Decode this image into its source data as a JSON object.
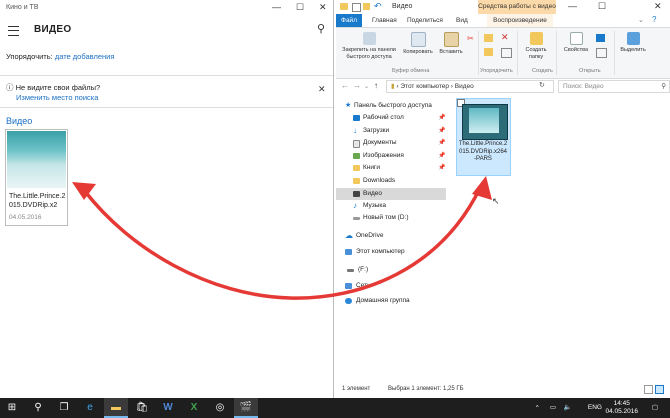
{
  "app": {
    "window_title": "Кино и ТВ",
    "page_title": "ВИДЕО",
    "sort_label": "Упорядочить:",
    "sort_value": "дате добавления",
    "notice_text": "Не видите свои файлы?",
    "notice_link": "Изменить место поиска",
    "section_title": "Видео",
    "video_name": "The.Little.Prince.2015.DVDRip.x2",
    "video_date": "04.05.2016"
  },
  "explorer": {
    "window_title": "Видео",
    "context_tab": "Средства работы с видео",
    "tabs": [
      "Файл",
      "Главная",
      "Поделиться",
      "Вид",
      "Воспроизведение"
    ],
    "ribbon": {
      "pin_label": "Закрепить на панели быстрого доступа",
      "copy_label": "Копировать",
      "paste_label": "Вставить",
      "new_folder_label": "Создать папку",
      "properties_label": "Свойства",
      "select_label": "Выделить",
      "groups": [
        "Буфер обмена",
        "Упорядочить",
        "Создать",
        "Открыть"
      ]
    },
    "address": {
      "path_root": "Этот компьютер",
      "path_current": "Видео",
      "search_placeholder": "Поиск: Видео"
    },
    "nav": {
      "quick_access": "Панель быстрого доступа",
      "desktop": "Рабочий стол",
      "downloads": "Загрузки",
      "documents": "Документы",
      "pictures": "Изображения",
      "books": "Книги",
      "downloads_en": "Downloads",
      "video": "Видео",
      "music": "Музыка",
      "new_volume": "Новый том (D:)",
      "onedrive": "OneDrive",
      "this_pc": "Этот компьютер",
      "drive_f": "(F:)",
      "network": "Сеть",
      "homegroup": "Домашняя группа"
    },
    "file_name": "The.Little.Prince.2015.DVDRip.x264-PARS",
    "status_count": "1 элемент",
    "status_selected": "Выбран 1 элемент: 1,25 ГБ"
  },
  "taskbar": {
    "lang": "ENG",
    "time": "14:45",
    "date": "04.05.2016"
  },
  "colors": {
    "accent": "#1979ca",
    "link": "#1a6fc4",
    "arrow": "#e53935",
    "selection": "#cce8ff",
    "context_tab": "#fcd9a8",
    "taskbar": "#1e1e1e"
  }
}
